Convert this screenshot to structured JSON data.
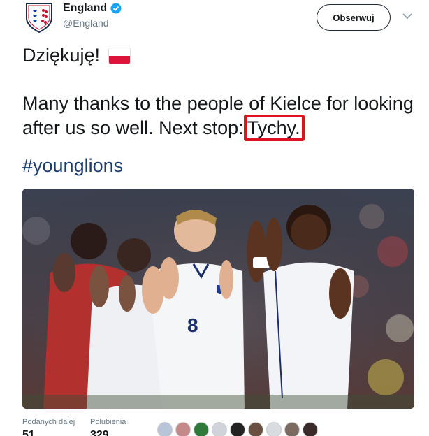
{
  "account": {
    "display_name": "England",
    "handle": "@England",
    "verified_icon": "verified-badge-icon"
  },
  "follow_button": {
    "label": "Obserwuj"
  },
  "menu_caret": {
    "icon": "chevron-down-icon"
  },
  "tweet": {
    "line1": "Dziękuję!",
    "flag_icon": "poland-flag-icon",
    "para2_before": "Many thanks to the people of Kielce for looking after us so well. Next stop:",
    "para2_highlight": "Tychy.",
    "hashtag": "#younglions"
  },
  "photo": {
    "description_icon": "tweet-photo",
    "jersey_number": "8"
  },
  "stats": {
    "retweets_label": "Podanych dalej",
    "retweets_value": "51",
    "likes_label": "Polubienia",
    "likes_value": "329"
  },
  "colors": {
    "highlight": "#e0101f",
    "hashtag": "#1b3d6e",
    "verified": "#1da1f2",
    "flag_red": "#dc143c"
  }
}
